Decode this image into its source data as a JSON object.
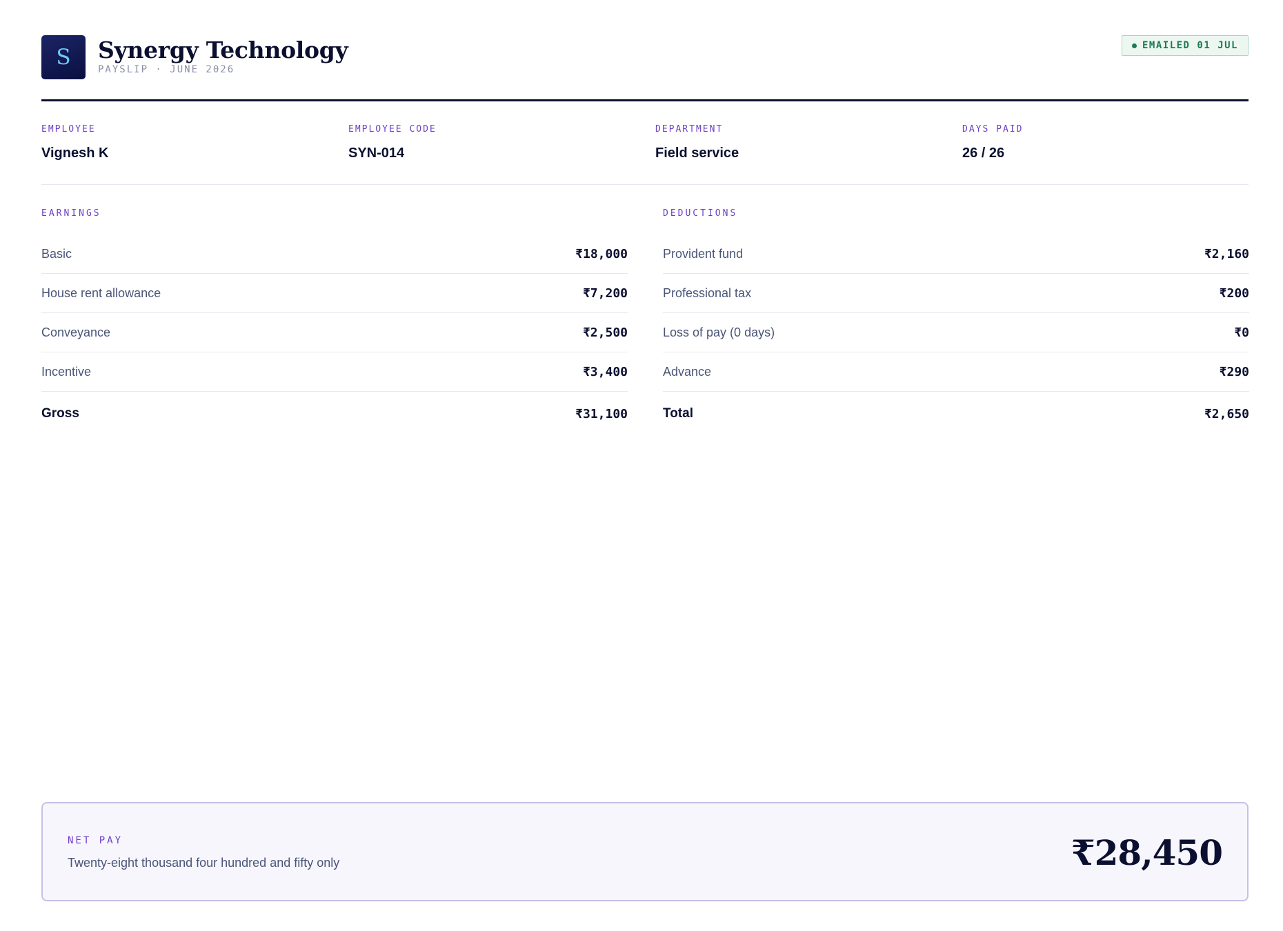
{
  "header": {
    "logo_letter": "S",
    "company": "Synergy Technology",
    "subtitle": "PAYSLIP · JUNE 2026",
    "status": "EMAILED 01 JUL"
  },
  "employee_info": [
    {
      "label": "EMPLOYEE",
      "value": "Vignesh K"
    },
    {
      "label": "EMPLOYEE CODE",
      "value": "SYN-014"
    },
    {
      "label": "DEPARTMENT",
      "value": "Field service"
    },
    {
      "label": "DAYS PAID",
      "value": "26 / 26"
    }
  ],
  "earnings": {
    "title": "EARNINGS",
    "rows": [
      {
        "label": "Basic",
        "amount": "₹18,000"
      },
      {
        "label": "House rent allowance",
        "amount": "₹7,200"
      },
      {
        "label": "Conveyance",
        "amount": "₹2,500"
      },
      {
        "label": "Incentive",
        "amount": "₹3,400"
      }
    ],
    "total_label": "Gross",
    "total_amount": "₹31,100"
  },
  "deductions": {
    "title": "DEDUCTIONS",
    "rows": [
      {
        "label": "Provident fund",
        "amount": "₹2,160"
      },
      {
        "label": "Professional tax",
        "amount": "₹200"
      },
      {
        "label": "Loss of pay (0 days)",
        "amount": "₹0"
      },
      {
        "label": "Advance",
        "amount": "₹290"
      }
    ],
    "total_label": "Total",
    "total_amount": "₹2,650"
  },
  "net_pay": {
    "label": "NET PAY",
    "words": "Twenty-eight thousand four hundred and fifty only",
    "amount": "₹28,450"
  },
  "colors": {
    "ink": "#0b1030",
    "accent": "#6c3fc4",
    "status_green": "#1e7a52"
  }
}
